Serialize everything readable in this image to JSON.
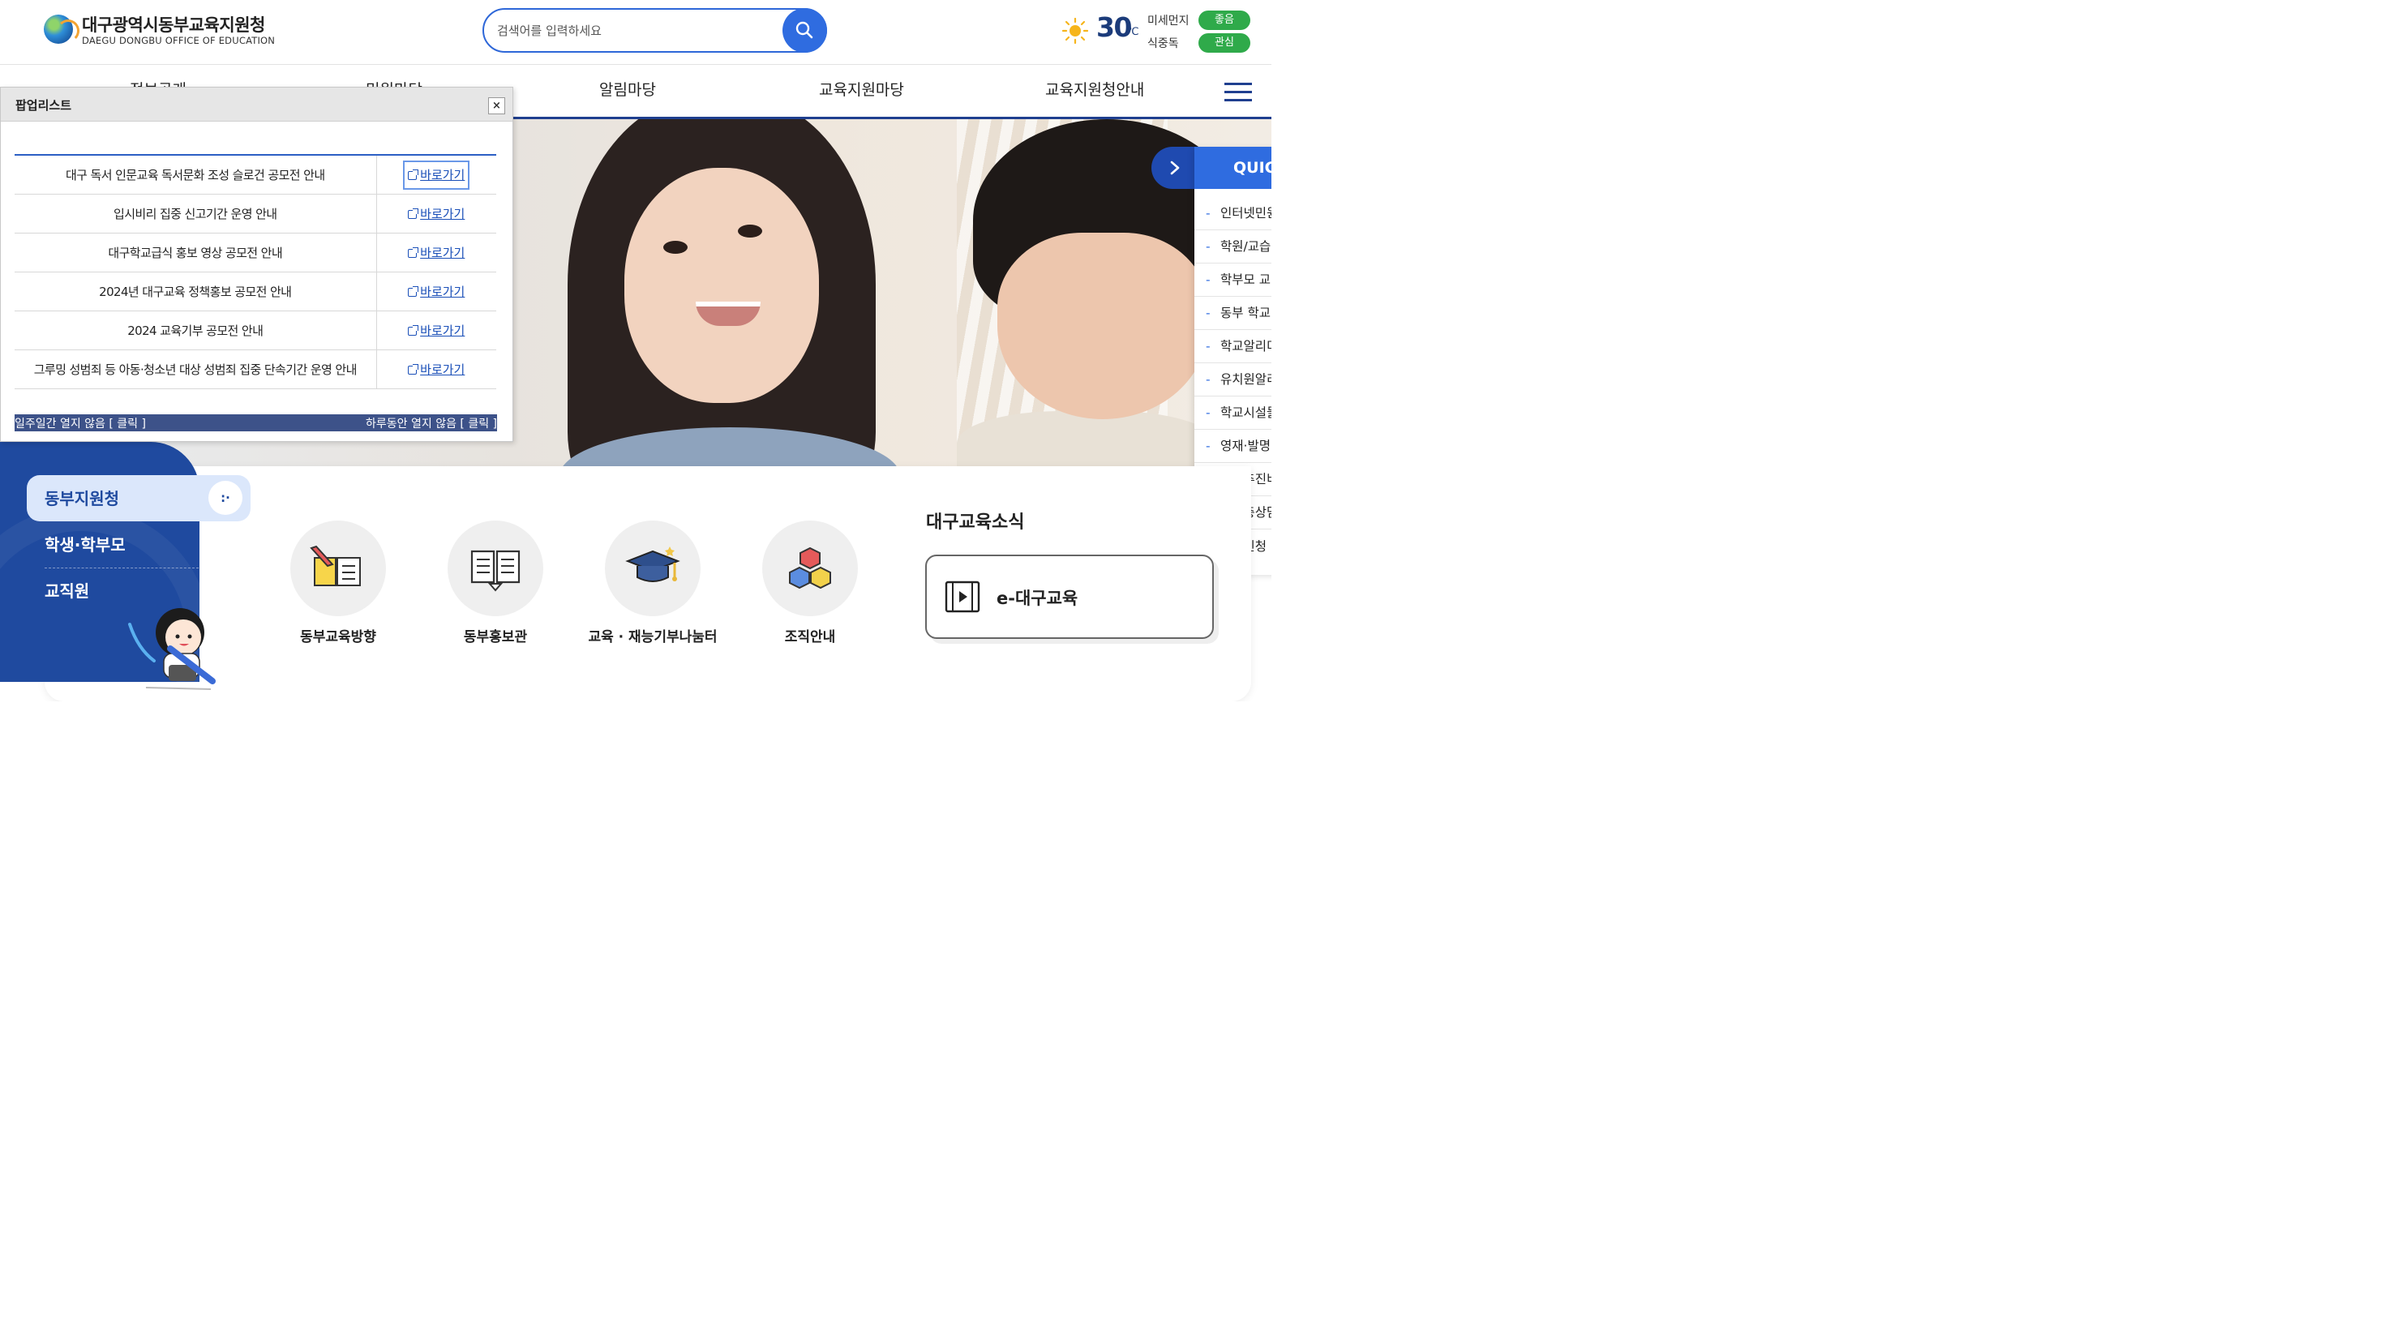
{
  "header": {
    "logo_korean": "대구광역시동부교육지원청",
    "logo_english": "DAEGU DONGBU OFFICE OF EDUCATION",
    "search_placeholder": "검색어를 입력하세요",
    "weather": {
      "temperature": "30",
      "unit": "℃",
      "fine_dust_label": "미세먼지",
      "fine_dust_status": "좋음",
      "food_poisoning_label": "식중독",
      "food_poisoning_status": "관심"
    }
  },
  "gnb": {
    "items": [
      "정보공개",
      "민원마당",
      "알림마당",
      "교육지원마당",
      "교육지원청안내"
    ]
  },
  "quick_menu": {
    "title": "QUICK",
    "items": [
      "인터넷민원",
      "학원/교습",
      "학부모 교",
      "동부 학교",
      "학교알리미",
      "유치원알리",
      "학교시설물",
      "영재·발명",
      "업무추진비",
      "성고충상담",
      "기부신청"
    ]
  },
  "popup": {
    "title": "팝업리스트",
    "close": "×",
    "rows": [
      {
        "title": "대구 독서 인문교육 독서문화 조성 슬로건 공모전 안내",
        "link": "바로가기"
      },
      {
        "title": "입시비리 집중 신고기간 운영 안내",
        "link": "바로가기"
      },
      {
        "title": "대구학교급식 홍보 영상 공모전 안내",
        "link": "바로가기"
      },
      {
        "title": "2024년 대구교육 정책홍보 공모전 안내",
        "link": "바로가기"
      },
      {
        "title": "2024 교육기부 공모전 안내",
        "link": "바로가기"
      },
      {
        "title": "그루밍 성범죄 등 아동·청소년 대상 성범죄 집중 단속기간 운영 안내",
        "link": "바로가기"
      }
    ],
    "footer_left": "일주일간 열지 않음 [ 클릭 ]",
    "footer_right": "하루동안 열지 않음 [ 클릭 ]"
  },
  "side_nav": {
    "active": "동부지원청",
    "active_dot": ":·",
    "items": [
      "학생·학부모",
      "교직원"
    ]
  },
  "quick_links": [
    {
      "label": "동부교육방향",
      "icon": "book-pencil-icon"
    },
    {
      "label": "동부홍보관",
      "icon": "open-book-icon"
    },
    {
      "label": "교육 · 재능기부나눔터",
      "icon": "graduation-cap-icon"
    },
    {
      "label": "조직안내",
      "icon": "cubes-icon"
    }
  ],
  "news": {
    "title": "대구교육소식",
    "e_label": "e-대구교육"
  },
  "colors": {
    "primary": "#1f4a9f",
    "accent": "#2f6ce0",
    "badge_green": "#2faa4a",
    "popup_footer": "#3d5289"
  }
}
